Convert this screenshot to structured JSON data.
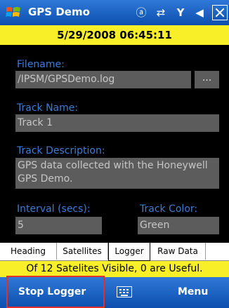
{
  "titlebar": {
    "app_title": "GPS Demo",
    "icons": [
      "windows-logo-icon",
      "mail-icon",
      "connectivity-icon",
      "signal-icon",
      "volume-icon",
      "close-icon"
    ],
    "mail_glyph": "ⓐ",
    "connectivity_glyph": "⇄",
    "signal_glyph": "Y",
    "volume_glyph": "◀"
  },
  "datetime": "5/29/2008 06:45:11",
  "form": {
    "filename_label": "Filename:",
    "filename_value": "/IPSM/GPSDemo.log",
    "browse_label": "...",
    "track_name_label": "Track Name:",
    "track_name_value": "Track 1",
    "track_desc_label": "Track Description:",
    "track_desc_value": "GPS data collected with the Honeywell GPS Demo.",
    "interval_label": "Interval (secs):",
    "interval_value": "5",
    "track_color_label": "Track Color:",
    "track_color_value": "Green"
  },
  "tabs": [
    "Heading",
    "Satellites",
    "Logger",
    "Raw Data"
  ],
  "active_tab": "Logger",
  "status": "Of 12 Satelites Visible, 0 are Useful.",
  "softkeys": {
    "left": "Stop Logger",
    "right": "Menu",
    "center_icon": "keyboard-icon"
  },
  "colors": {
    "title_blue": "#0c4fae",
    "yellow": "#f8ef28",
    "label_blue": "#3f7cd6",
    "field_gray": "#5c5c5c",
    "highlight_red": "#e2312a"
  }
}
